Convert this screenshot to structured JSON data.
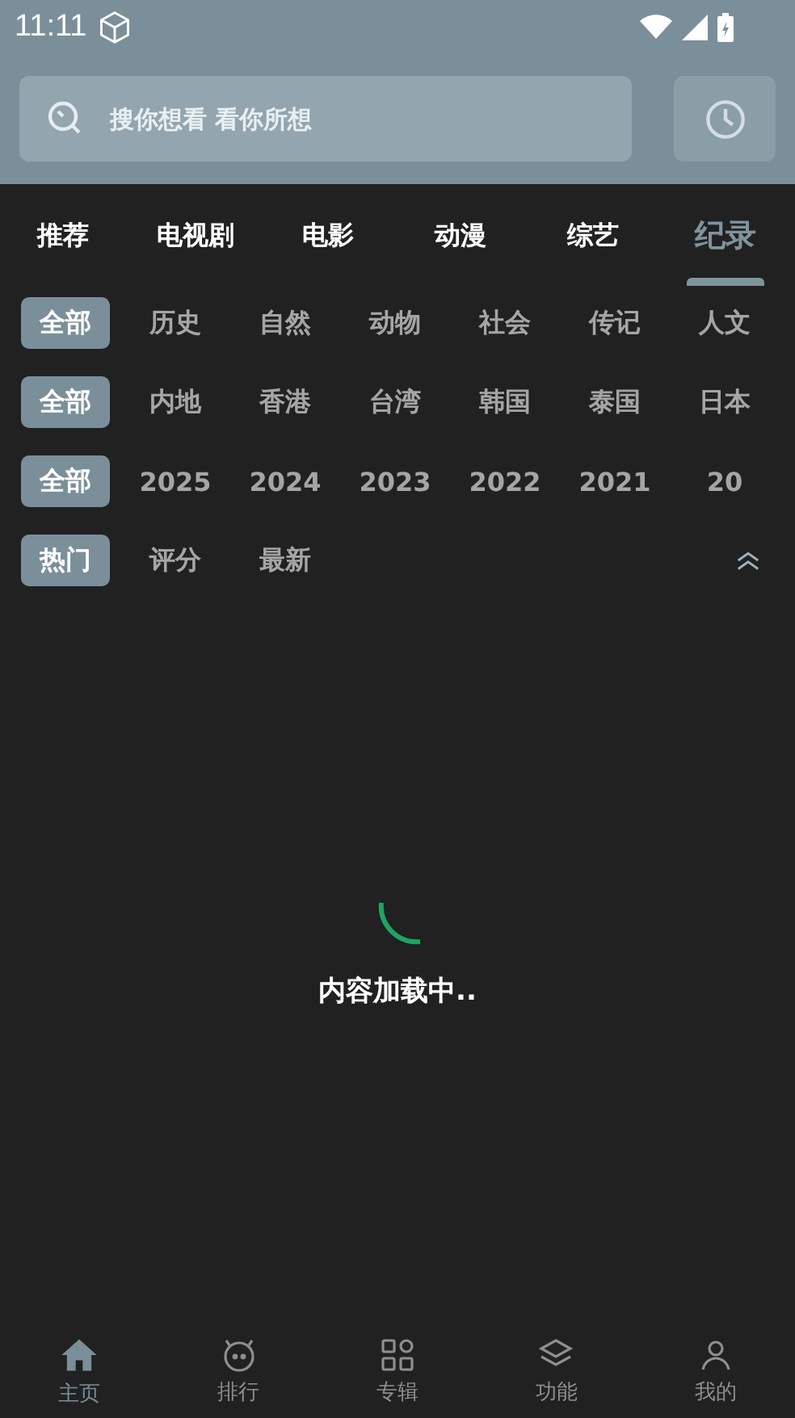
{
  "status_bar": {
    "time": "11:11"
  },
  "search": {
    "placeholder": "搜你想看 看你所想"
  },
  "tabs": [
    {
      "label": "推荐",
      "selected": false
    },
    {
      "label": "电视剧",
      "selected": false
    },
    {
      "label": "电影",
      "selected": false
    },
    {
      "label": "动漫",
      "selected": false
    },
    {
      "label": "综艺",
      "selected": false
    },
    {
      "label": "纪录",
      "selected": true
    }
  ],
  "filters": [
    {
      "options": [
        {
          "label": "全部",
          "selected": true
        },
        {
          "label": "历史",
          "selected": false
        },
        {
          "label": "自然",
          "selected": false
        },
        {
          "label": "动物",
          "selected": false
        },
        {
          "label": "社会",
          "selected": false
        },
        {
          "label": "传记",
          "selected": false
        },
        {
          "label": "人文",
          "selected": false
        }
      ]
    },
    {
      "options": [
        {
          "label": "全部",
          "selected": true
        },
        {
          "label": "内地",
          "selected": false
        },
        {
          "label": "香港",
          "selected": false
        },
        {
          "label": "台湾",
          "selected": false
        },
        {
          "label": "韩国",
          "selected": false
        },
        {
          "label": "泰国",
          "selected": false
        },
        {
          "label": "日本",
          "selected": false
        }
      ]
    },
    {
      "options": [
        {
          "label": "全部",
          "selected": true
        },
        {
          "label": "2025",
          "selected": false
        },
        {
          "label": "2024",
          "selected": false
        },
        {
          "label": "2023",
          "selected": false
        },
        {
          "label": "2022",
          "selected": false
        },
        {
          "label": "2021",
          "selected": false
        },
        {
          "label": "20",
          "selected": false
        }
      ]
    },
    {
      "options": [
        {
          "label": "热门",
          "selected": true
        },
        {
          "label": "评分",
          "selected": false
        },
        {
          "label": "最新",
          "selected": false
        }
      ]
    }
  ],
  "loading": {
    "text": "内容加载中.."
  },
  "nav": [
    {
      "label": "主页",
      "kind": "home",
      "selected": true
    },
    {
      "label": "排行",
      "kind": "ranking",
      "selected": false
    },
    {
      "label": "专辑",
      "kind": "albums",
      "selected": false
    },
    {
      "label": "功能",
      "kind": "features",
      "selected": false
    },
    {
      "label": "我的",
      "kind": "profile",
      "selected": false
    }
  ]
}
